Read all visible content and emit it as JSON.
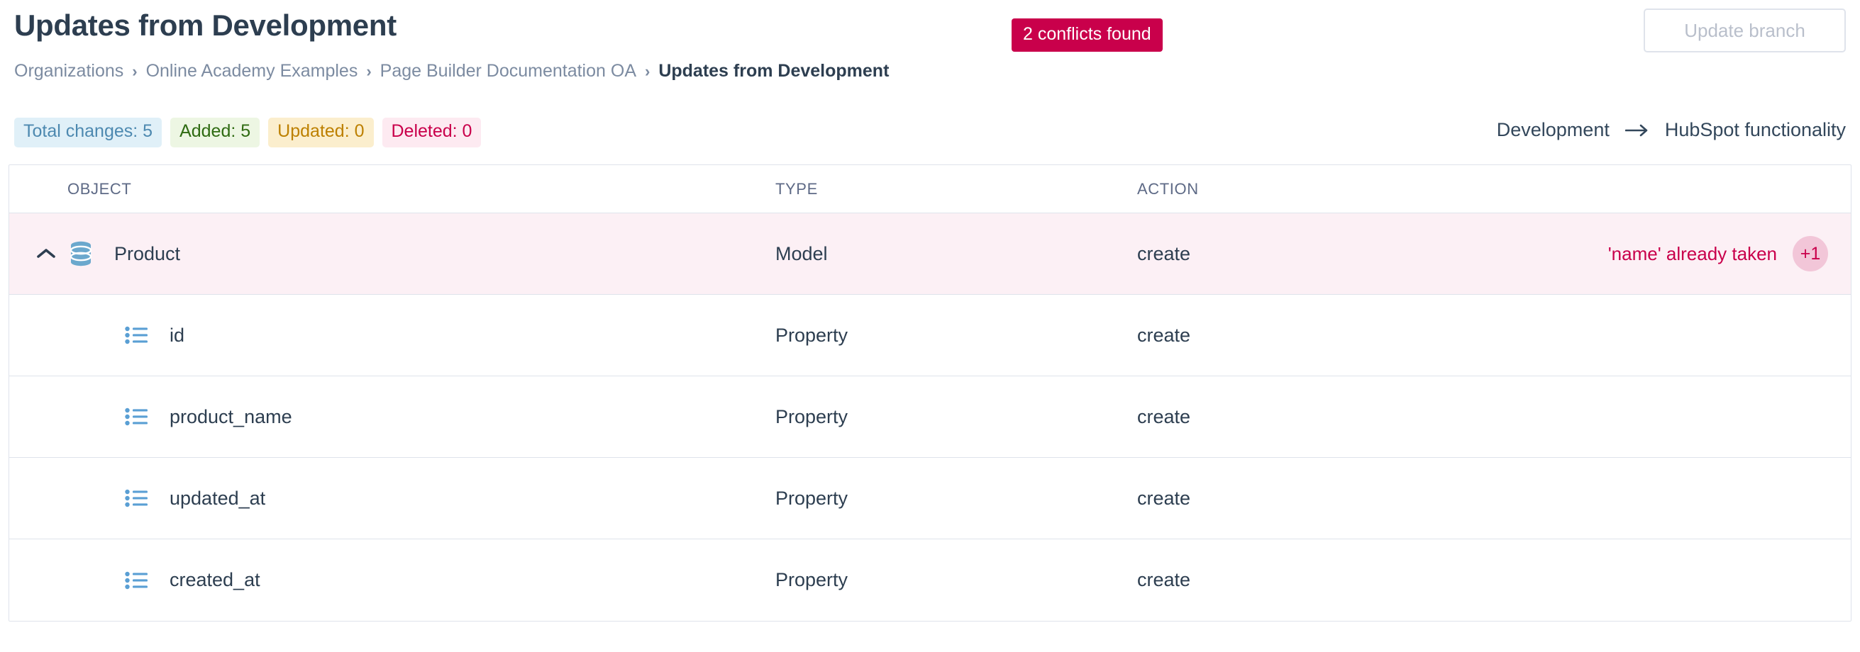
{
  "header": {
    "title": "Updates from Development",
    "conflicts_badge": "2 conflicts found",
    "update_branch_label": "Update branch"
  },
  "breadcrumb": {
    "separator": "›",
    "items": [
      {
        "label": "Organizations",
        "current": false
      },
      {
        "label": "Online Academy Examples",
        "current": false
      },
      {
        "label": "Page Builder Documentation OA",
        "current": false
      },
      {
        "label": "Updates from Development",
        "current": true
      }
    ]
  },
  "stats": {
    "total": "Total changes: 5",
    "added": "Added: 5",
    "updated": "Updated: 0",
    "deleted": "Deleted: 0"
  },
  "branch_compare": {
    "source": "Development",
    "arrow": "→",
    "target": "HubSpot functionality"
  },
  "table": {
    "columns": {
      "object": "OBJECT",
      "type": "TYPE",
      "action": "ACTION"
    },
    "rows": [
      {
        "name": "Product",
        "type": "Model",
        "action": "create",
        "icon": "database-icon",
        "level": 0,
        "expanded": true,
        "conflict": true,
        "conflict_text": "'name' already taken",
        "more_count": "+1"
      },
      {
        "name": "id",
        "type": "Property",
        "action": "create",
        "icon": "property-list-icon",
        "level": 1,
        "conflict": false
      },
      {
        "name": "product_name",
        "type": "Property",
        "action": "create",
        "icon": "property-list-icon",
        "level": 1,
        "conflict": false
      },
      {
        "name": "updated_at",
        "type": "Property",
        "action": "create",
        "icon": "property-list-icon",
        "level": 1,
        "conflict": false
      },
      {
        "name": "created_at",
        "type": "Property",
        "action": "create",
        "icon": "property-list-icon",
        "level": 1,
        "conflict": false
      }
    ]
  },
  "colors": {
    "conflict_red": "#c9004b",
    "conflict_row_bg": "#fcf0f5",
    "accent_blue": "#6ba8cd",
    "text_dark": "#2d3e50",
    "muted": "#7c8ba1",
    "border": "#dfe3eb"
  }
}
